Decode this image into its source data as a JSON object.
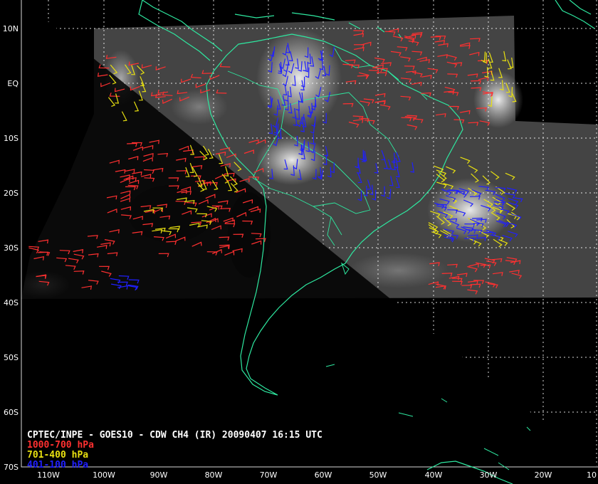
{
  "title": "CPTEC/INPE - GOES10 - CDW CH4 (IR) 20090407 16:15 UTC",
  "legend": [
    {
      "label": "1000-700 hPa",
      "color": "#ff3030"
    },
    {
      "label": "701-400 hPa",
      "color": "#e8e010"
    },
    {
      "label": "401-100 hPa",
      "color": "#2020ff"
    }
  ],
  "lat_labels": [
    "10N",
    "EQ",
    "10S",
    "20S",
    "30S",
    "40S",
    "50S",
    "60S",
    "70S"
  ],
  "lon_labels": [
    "110W",
    "100W",
    "90W",
    "80W",
    "70W",
    "60W",
    "50W",
    "40W",
    "30W",
    "20W",
    "10"
  ],
  "colors": {
    "background": "#000000",
    "coastline": "#2ee8a0",
    "grid": "#ffffff",
    "cloud_low": "#3a3a3a",
    "cloud_high": "#f0f0f0"
  }
}
